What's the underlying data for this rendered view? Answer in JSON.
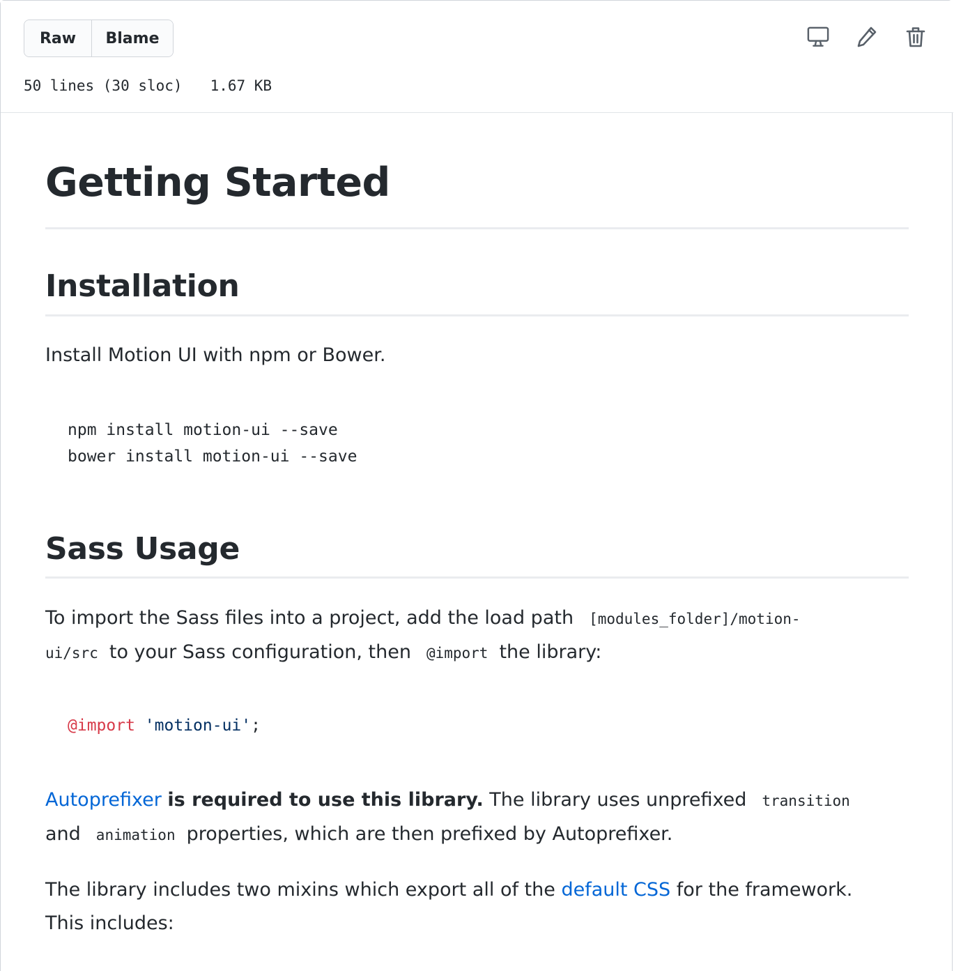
{
  "toolbar": {
    "raw_label": "Raw",
    "blame_label": "Blame",
    "file_lines": "50 lines (30 sloc)",
    "file_size": "1.67 KB",
    "icons": [
      "desktop-icon",
      "pencil-icon",
      "trash-icon"
    ]
  },
  "doc": {
    "title": "Getting Started",
    "installation": {
      "heading": "Installation",
      "intro": "Install Motion UI with npm or Bower.",
      "code_line_1": "npm install motion-ui --save",
      "code_line_2": "bower install motion-ui --save"
    },
    "sass": {
      "heading": "Sass Usage",
      "p1_part1": "To import the Sass files into a project, add the load path",
      "p1_code1a": "[modules_folder]/motion-",
      "p1_code1b": "ui/src",
      "p1_part2": "to your Sass configuration, then",
      "p1_code2": "@import",
      "p1_part3": "the library:",
      "code_kw": "@import",
      "code_str": "'motion-ui'",
      "code_end": ";",
      "p2_link": "Autoprefixer",
      "p2_bold": "is required to use this library.",
      "p2_part1": "The library uses unprefixed",
      "p2_code1": "transition",
      "p2_and": "and",
      "p2_code2": "animation",
      "p2_part2": "properties, which are then prefixed by Autoprefixer.",
      "p3_part1": "The library includes two mixins which export all of the",
      "p3_link": "default CSS",
      "p3_part2": "for the framework.",
      "p3_line2": "This includes:"
    }
  },
  "colors": {
    "link": "#0366d6",
    "text": "#24292e",
    "keyword": "#d73a49",
    "string": "#032f62",
    "border": "#e1e4e8"
  }
}
